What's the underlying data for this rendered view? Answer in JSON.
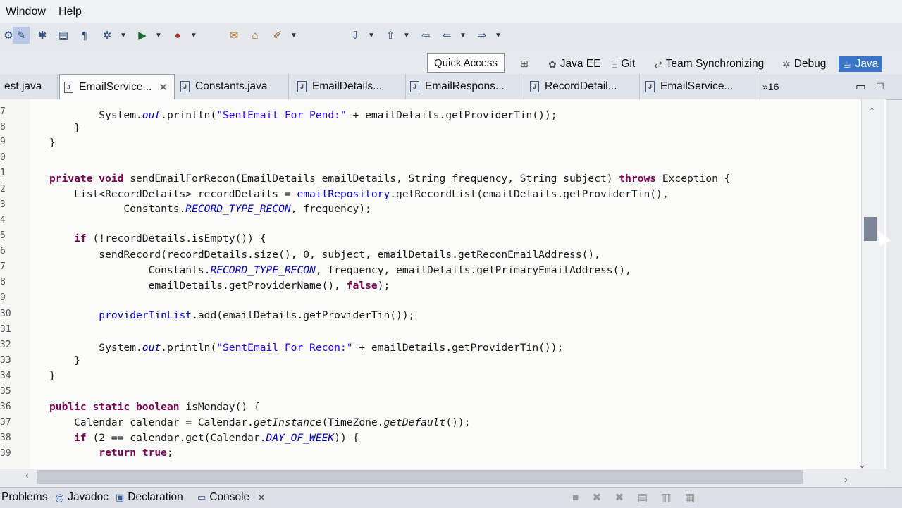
{
  "menu": {
    "items": [
      "Window",
      "Help"
    ]
  },
  "quick_access": {
    "label": "Quick Access"
  },
  "perspectives": [
    {
      "label": "Java EE",
      "icon": "java-ee-icon"
    },
    {
      "label": "Git",
      "icon": "git-icon"
    },
    {
      "label": "Team Synchronizing",
      "icon": "team-sync-icon"
    },
    {
      "label": "Debug",
      "icon": "bug-icon"
    },
    {
      "label": "Java",
      "icon": "java-perspective-icon",
      "active": true
    }
  ],
  "editor_tabs": [
    {
      "label": "est.java"
    },
    {
      "label": "EmailService...",
      "active": true
    },
    {
      "label": "Constants.java"
    },
    {
      "label": "EmailDetails..."
    },
    {
      "label": "EmailRespons..."
    },
    {
      "label": "RecordDetail..."
    },
    {
      "label": "EmailService..."
    }
  ],
  "overflow": {
    "label": "»16"
  },
  "line_numbers": [
    "7",
    "8",
    "9",
    "0",
    "1",
    "2",
    "3",
    "4",
    "5",
    "6",
    "7",
    "8",
    "9",
    "30",
    "31",
    "32",
    "33",
    "34",
    "35",
    "36",
    "37",
    "38",
    "39"
  ],
  "code": {
    "l7a": "        System.",
    "l7b": "out",
    "l7c": ".println(",
    "l7d": "\"SentEmail For Pend:\"",
    "l7e": " + emailDetails.getProviderTin());",
    "l8": "    }",
    "l9": "}",
    "l11a": "private void",
    "l11b": " sendEmailForRecon(EmailDetails emailDetails, String frequency, String subject) ",
    "l11c": "throws",
    "l11d": " Exception {",
    "l12a": "    List<RecordDetails> recordDetails = ",
    "l12b": "emailRepository",
    "l12c": ".getRecordList(emailDetails.getProviderTin(),",
    "l13a": "            Constants.",
    "l13b": "RECORD_TYPE_RECON",
    "l13c": ", frequency);",
    "l15a": "    if",
    "l15b": " (!recordDetails.isEmpty()) {",
    "l16": "        sendRecord(recordDetails.size(), 0, subject, emailDetails.getReconEmailAddress(),",
    "l17a": "                Constants.",
    "l17b": "RECORD_TYPE_RECON",
    "l17c": ", frequency, emailDetails.getPrimaryEmailAddress(),",
    "l18a": "                emailDetails.getProviderName(), ",
    "l18b": "false",
    "l18c": ");",
    "l30a": "        providerTinList",
    "l30b": ".add(emailDetails.getProviderTin());",
    "l32a": "        System.",
    "l32b": "out",
    "l32c": ".println(",
    "l32d": "\"SentEmail For Recon:\"",
    "l32e": " + emailDetails.getProviderTin());",
    "l33": "    }",
    "l34": "}",
    "l36a": "public static boolean",
    "l36b": " isMonday() {",
    "l37a": "    Calendar calendar = Calendar.",
    "l37b": "getInstance",
    "l37c": "(TimeZone.",
    "l37d": "getDefault",
    "l37e": "());",
    "l38a": "    if",
    "l38b": " (2 == calendar.get(Calendar.",
    "l38c": "DAY_OF_WEEK",
    "l38d": ")) {",
    "l39a": "        return true",
    "l39b": ";"
  },
  "bottom_tabs": [
    {
      "label": "Problems"
    },
    {
      "label": "Javadoc",
      "icon": "at-icon"
    },
    {
      "label": "Declaration",
      "icon": "declaration-icon"
    },
    {
      "label": "Console",
      "icon": "console-icon"
    }
  ]
}
